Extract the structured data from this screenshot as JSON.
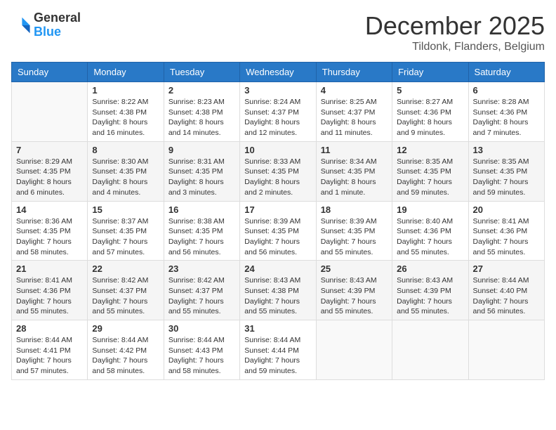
{
  "header": {
    "logo_line1": "General",
    "logo_line2": "Blue",
    "month_title": "December 2025",
    "location": "Tildonk, Flanders, Belgium"
  },
  "weekdays": [
    "Sunday",
    "Monday",
    "Tuesday",
    "Wednesday",
    "Thursday",
    "Friday",
    "Saturday"
  ],
  "weeks": [
    [
      {
        "day": null
      },
      {
        "day": "1",
        "sunrise": "8:22 AM",
        "sunset": "4:38 PM",
        "daylight": "8 hours and 16 minutes."
      },
      {
        "day": "2",
        "sunrise": "8:23 AM",
        "sunset": "4:38 PM",
        "daylight": "8 hours and 14 minutes."
      },
      {
        "day": "3",
        "sunrise": "8:24 AM",
        "sunset": "4:37 PM",
        "daylight": "8 hours and 12 minutes."
      },
      {
        "day": "4",
        "sunrise": "8:25 AM",
        "sunset": "4:37 PM",
        "daylight": "8 hours and 11 minutes."
      },
      {
        "day": "5",
        "sunrise": "8:27 AM",
        "sunset": "4:36 PM",
        "daylight": "8 hours and 9 minutes."
      },
      {
        "day": "6",
        "sunrise": "8:28 AM",
        "sunset": "4:36 PM",
        "daylight": "8 hours and 7 minutes."
      }
    ],
    [
      {
        "day": "7",
        "sunrise": "8:29 AM",
        "sunset": "4:35 PM",
        "daylight": "8 hours and 6 minutes."
      },
      {
        "day": "8",
        "sunrise": "8:30 AM",
        "sunset": "4:35 PM",
        "daylight": "8 hours and 4 minutes."
      },
      {
        "day": "9",
        "sunrise": "8:31 AM",
        "sunset": "4:35 PM",
        "daylight": "8 hours and 3 minutes."
      },
      {
        "day": "10",
        "sunrise": "8:33 AM",
        "sunset": "4:35 PM",
        "daylight": "8 hours and 2 minutes."
      },
      {
        "day": "11",
        "sunrise": "8:34 AM",
        "sunset": "4:35 PM",
        "daylight": "8 hours and 1 minute."
      },
      {
        "day": "12",
        "sunrise": "8:35 AM",
        "sunset": "4:35 PM",
        "daylight": "7 hours and 59 minutes."
      },
      {
        "day": "13",
        "sunrise": "8:35 AM",
        "sunset": "4:35 PM",
        "daylight": "7 hours and 59 minutes."
      }
    ],
    [
      {
        "day": "14",
        "sunrise": "8:36 AM",
        "sunset": "4:35 PM",
        "daylight": "7 hours and 58 minutes."
      },
      {
        "day": "15",
        "sunrise": "8:37 AM",
        "sunset": "4:35 PM",
        "daylight": "7 hours and 57 minutes."
      },
      {
        "day": "16",
        "sunrise": "8:38 AM",
        "sunset": "4:35 PM",
        "daylight": "7 hours and 56 minutes."
      },
      {
        "day": "17",
        "sunrise": "8:39 AM",
        "sunset": "4:35 PM",
        "daylight": "7 hours and 56 minutes."
      },
      {
        "day": "18",
        "sunrise": "8:39 AM",
        "sunset": "4:35 PM",
        "daylight": "7 hours and 55 minutes."
      },
      {
        "day": "19",
        "sunrise": "8:40 AM",
        "sunset": "4:36 PM",
        "daylight": "7 hours and 55 minutes."
      },
      {
        "day": "20",
        "sunrise": "8:41 AM",
        "sunset": "4:36 PM",
        "daylight": "7 hours and 55 minutes."
      }
    ],
    [
      {
        "day": "21",
        "sunrise": "8:41 AM",
        "sunset": "4:36 PM",
        "daylight": "7 hours and 55 minutes."
      },
      {
        "day": "22",
        "sunrise": "8:42 AM",
        "sunset": "4:37 PM",
        "daylight": "7 hours and 55 minutes."
      },
      {
        "day": "23",
        "sunrise": "8:42 AM",
        "sunset": "4:37 PM",
        "daylight": "7 hours and 55 minutes."
      },
      {
        "day": "24",
        "sunrise": "8:43 AM",
        "sunset": "4:38 PM",
        "daylight": "7 hours and 55 minutes."
      },
      {
        "day": "25",
        "sunrise": "8:43 AM",
        "sunset": "4:39 PM",
        "daylight": "7 hours and 55 minutes."
      },
      {
        "day": "26",
        "sunrise": "8:43 AM",
        "sunset": "4:39 PM",
        "daylight": "7 hours and 55 minutes."
      },
      {
        "day": "27",
        "sunrise": "8:44 AM",
        "sunset": "4:40 PM",
        "daylight": "7 hours and 56 minutes."
      }
    ],
    [
      {
        "day": "28",
        "sunrise": "8:44 AM",
        "sunset": "4:41 PM",
        "daylight": "7 hours and 57 minutes."
      },
      {
        "day": "29",
        "sunrise": "8:44 AM",
        "sunset": "4:42 PM",
        "daylight": "7 hours and 58 minutes."
      },
      {
        "day": "30",
        "sunrise": "8:44 AM",
        "sunset": "4:43 PM",
        "daylight": "7 hours and 58 minutes."
      },
      {
        "day": "31",
        "sunrise": "8:44 AM",
        "sunset": "4:44 PM",
        "daylight": "7 hours and 59 minutes."
      },
      {
        "day": null
      },
      {
        "day": null
      },
      {
        "day": null
      }
    ]
  ],
  "labels": {
    "sunrise": "Sunrise:",
    "sunset": "Sunset:",
    "daylight": "Daylight:"
  }
}
